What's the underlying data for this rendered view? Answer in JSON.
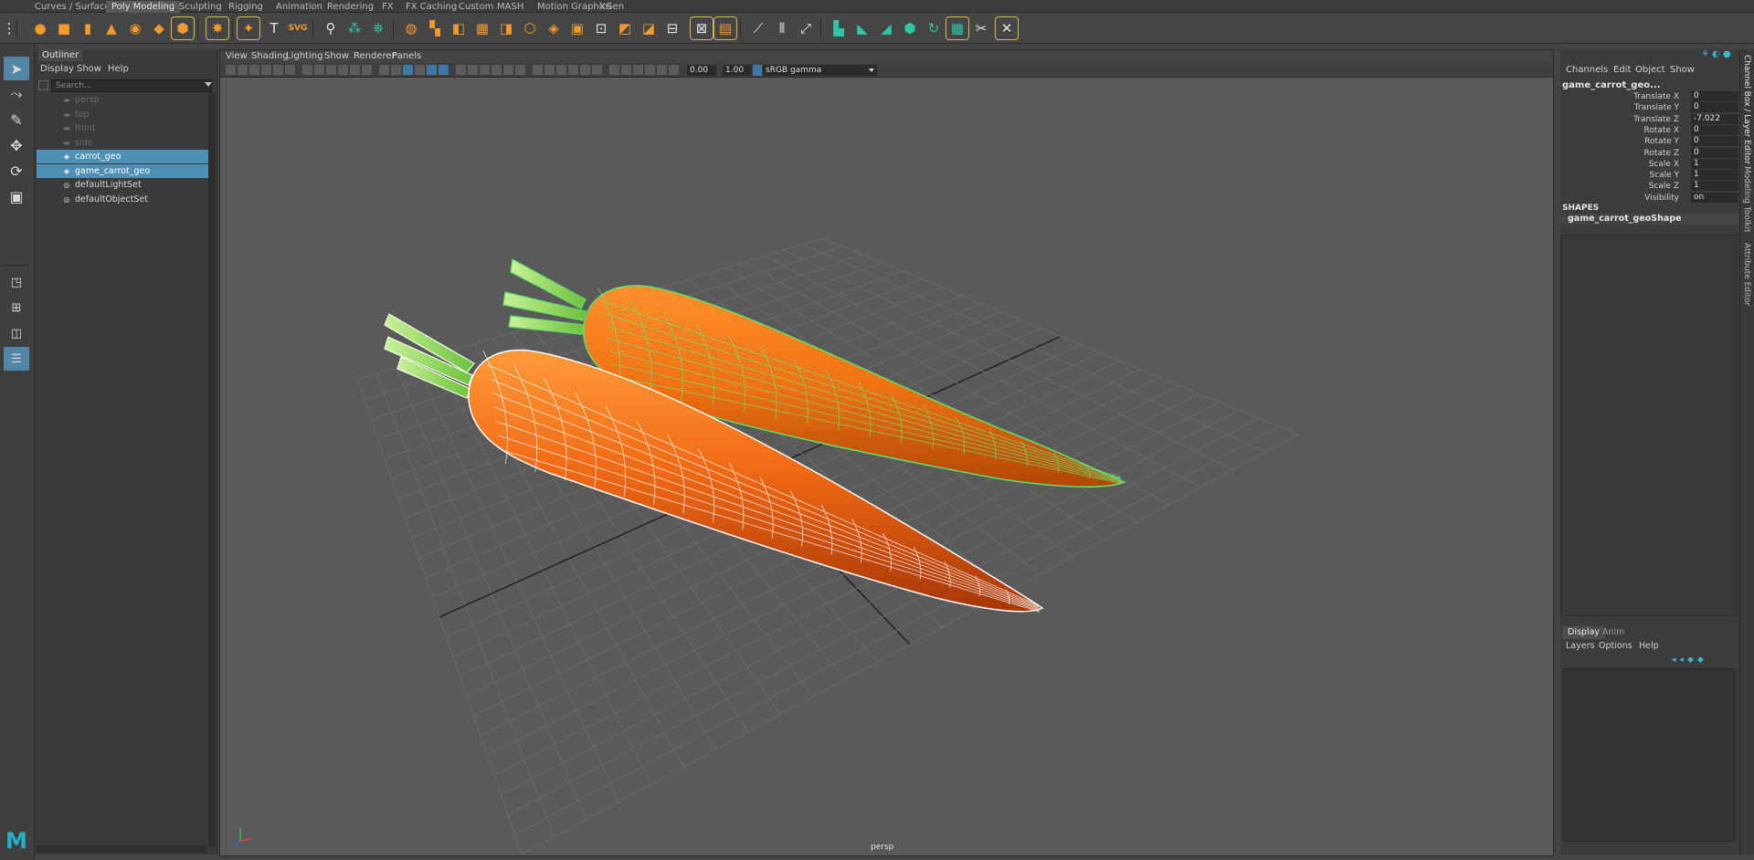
{
  "shelf_tabs": [
    "Curves / Surfaces",
    "Poly Modeling",
    "Sculpting",
    "Rigging",
    "Animation",
    "Rendering",
    "FX",
    "FX Caching",
    "Custom",
    "MASH",
    "Motion Graphics",
    "XGen"
  ],
  "shelf_active_tab": "Poly Modeling",
  "shelf_text_icons": {
    "text": "T",
    "svg": "SVG"
  },
  "outliner": {
    "title": "Outliner",
    "menu": [
      "Display",
      "Show",
      "Help"
    ],
    "search_placeholder": "Search...",
    "items": [
      {
        "label": "persp",
        "icon": "camera-icon",
        "state": "dim"
      },
      {
        "label": "top",
        "icon": "camera-icon",
        "state": "dim"
      },
      {
        "label": "front",
        "icon": "camera-icon",
        "state": "dim"
      },
      {
        "label": "side",
        "icon": "camera-icon",
        "state": "dim"
      },
      {
        "label": "carrot_geo",
        "icon": "mesh-icon",
        "state": "selected"
      },
      {
        "label": "game_carrot_geo",
        "icon": "mesh-icon",
        "state": "selected"
      },
      {
        "label": "defaultLightSet",
        "icon": "set-icon",
        "state": "normal"
      },
      {
        "label": "defaultObjectSet",
        "icon": "set-icon",
        "state": "normal"
      }
    ]
  },
  "viewport": {
    "menu": [
      "View",
      "Shading",
      "Lighting",
      "Show",
      "Renderer",
      "Panels"
    ],
    "exposure": "0.00",
    "gamma": "1.00",
    "color_space": "sRGB gamma",
    "camera_label": "persp"
  },
  "channel_box": {
    "menu": [
      "Channels",
      "Edit",
      "Object",
      "Show"
    ],
    "object_name": "game_carrot_geo...",
    "channels": [
      {
        "name": "Translate X",
        "value": "0"
      },
      {
        "name": "Translate Y",
        "value": "0"
      },
      {
        "name": "Translate Z",
        "value": "-7.022"
      },
      {
        "name": "Rotate X",
        "value": "0"
      },
      {
        "name": "Rotate Y",
        "value": "0"
      },
      {
        "name": "Rotate Z",
        "value": "0"
      },
      {
        "name": "Scale X",
        "value": "1"
      },
      {
        "name": "Scale Y",
        "value": "1"
      },
      {
        "name": "Scale Z",
        "value": "1"
      },
      {
        "name": "Visibility",
        "value": "on"
      }
    ],
    "shapes_heading": "SHAPES",
    "shape_name": "game_carrot_geoShape"
  },
  "layer_editor": {
    "tabs": [
      "Display",
      "Anim"
    ],
    "active_tab": "Display",
    "menu": [
      "Layers",
      "Options",
      "Help"
    ]
  },
  "side_tabs": [
    "Channel Box / Layer Editor",
    "Modeling Toolkit",
    "Attribute Editor"
  ],
  "colors": {
    "selection_blue": "#4d8fb5",
    "wire_green": "#5de26a",
    "carrot_orange": "#f06a14",
    "maya_logo_teal": "#20b2c8"
  }
}
